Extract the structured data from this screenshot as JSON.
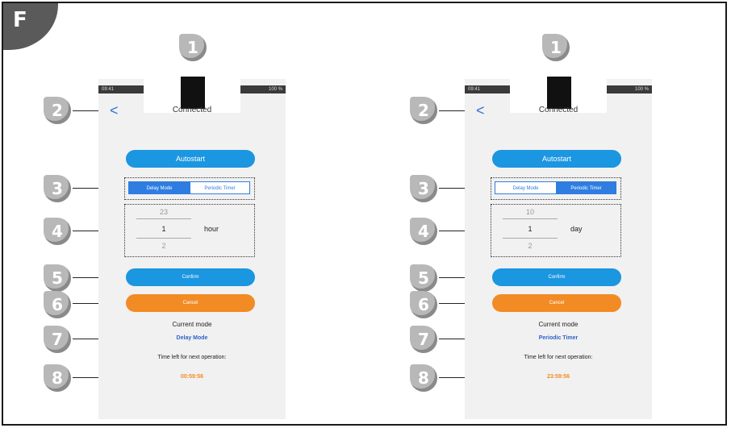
{
  "section_label": "F",
  "callout_numbers": [
    "1",
    "2",
    "3",
    "4",
    "5",
    "6",
    "7",
    "8"
  ],
  "colors": {
    "primary_blue": "#1b96e0",
    "segment_blue": "#2f7de0",
    "cancel_orange": "#f28b24",
    "mode_text_blue": "#2f62c8",
    "badge_gray": "#b8b8b8"
  },
  "icons": {
    "back": "chevron-left-icon"
  },
  "screens": [
    {
      "status_time": "09:41",
      "status_battery": "100 %",
      "back_glyph": "<",
      "title": "Connected",
      "autostart_label": "Autostart",
      "tabs": [
        {
          "label": "Delay Mode",
          "active": true
        },
        {
          "label": "Periodic Timer",
          "active": false
        }
      ],
      "picker": {
        "above": "23",
        "selected": "1",
        "below": "2",
        "unit": "hour"
      },
      "confirm_label": "Confirm",
      "cancel_label": "Cancel",
      "current_mode_label": "Current mode",
      "current_mode_value": "Delay Mode",
      "time_left_label": "Time left for next operation:",
      "time_left_value": "00:59:56"
    },
    {
      "status_time": "09:41",
      "status_battery": "100 %",
      "back_glyph": "<",
      "title": "Connected",
      "autostart_label": "Autostart",
      "tabs": [
        {
          "label": "Delay Mode",
          "active": false
        },
        {
          "label": "Periodic Timer",
          "active": true
        }
      ],
      "picker": {
        "above": "10",
        "selected": "1",
        "below": "2",
        "unit": "day"
      },
      "confirm_label": "Confirm",
      "cancel_label": "Cancel",
      "current_mode_label": "Current mode",
      "current_mode_value": "Periodic Timer",
      "time_left_label": "Time left for next operation:",
      "time_left_value": "23:59:56"
    }
  ]
}
